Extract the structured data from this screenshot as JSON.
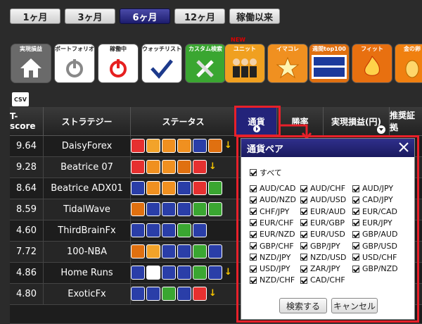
{
  "period_tabs": [
    {
      "label": "1ヶ月",
      "active": false
    },
    {
      "label": "3ヶ月",
      "active": false
    },
    {
      "label": "6ヶ月",
      "active": true
    },
    {
      "label": "12ヶ月",
      "active": false
    },
    {
      "label": "稼働以来",
      "active": false
    }
  ],
  "category_icons": [
    {
      "label": "実現損益",
      "icon": "home-icon",
      "color": "#6a6a6a"
    },
    {
      "label": "ポートフォリオ",
      "icon": "power-icon",
      "color": "#ffffff"
    },
    {
      "label": "稼働中",
      "icon": "power-on-icon",
      "color": "#ffffff"
    },
    {
      "label": "ウォッチリスト",
      "icon": "check-icon",
      "color": "#ffffff"
    },
    {
      "label": "カスタム検索",
      "icon": "tools-icon",
      "color": "#3aa631"
    },
    {
      "label": "ユニット",
      "icon": "team-icon",
      "color": "#f0a020"
    },
    {
      "label": "イマコレ",
      "icon": "star-icon",
      "color": "#f09020"
    },
    {
      "label": "週間top100",
      "icon": "top100-icon",
      "color": "#e07010"
    },
    {
      "label": "フィット",
      "icon": "flame-icon",
      "color": "#e87010"
    },
    {
      "label": "金の卵",
      "icon": "egg-icon",
      "color": "#f08010"
    }
  ],
  "new_badge": "NEW",
  "csv_label": "CSV",
  "table": {
    "headers": [
      "T-score",
      "ストラテジー",
      "ステータス",
      "通貨",
      "勝率",
      "実現損益(円)",
      "推奨証拠"
    ],
    "rows": [
      {
        "tscore": "9.64",
        "strategy": "DaisyForex"
      },
      {
        "tscore": "9.28",
        "strategy": "Beatrice 07"
      },
      {
        "tscore": "8.64",
        "strategy": "Beatrice ADX01"
      },
      {
        "tscore": "8.59",
        "strategy": "TidalWave"
      },
      {
        "tscore": "4.60",
        "strategy": "ThirdBrainFx"
      },
      {
        "tscore": "7.72",
        "strategy": "100-NBA"
      },
      {
        "tscore": "4.86",
        "strategy": "Home Runs"
      },
      {
        "tscore": "4.80",
        "strategy": "ExoticFx"
      }
    ]
  },
  "currency_panel": {
    "title": "通貨ペア",
    "all_label": "すべて",
    "pairs": [
      "AUD/CAD",
      "AUD/CHF",
      "AUD/JPY",
      "AUD/NZD",
      "AUD/USD",
      "CAD/JPY",
      "CHF/JPY",
      "EUR/AUD",
      "EUR/CAD",
      "EUR/CHF",
      "EUR/GBP",
      "EUR/JPY",
      "EUR/NZD",
      "EUR/USD",
      "GBP/AUD",
      "GBP/CHF",
      "GBP/JPY",
      "GBP/USD",
      "NZD/JPY",
      "NZD/USD",
      "USD/CHF",
      "USD/JPY",
      "ZAR/JPY",
      "GBP/NZD",
      "NZD/CHF",
      "CAD/CHF"
    ],
    "search_button": "検索する",
    "cancel_button": "キャンセル"
  },
  "colors": {
    "accent": "#e8202a",
    "header_active": "#23237a",
    "arrow": "#f5c400"
  }
}
